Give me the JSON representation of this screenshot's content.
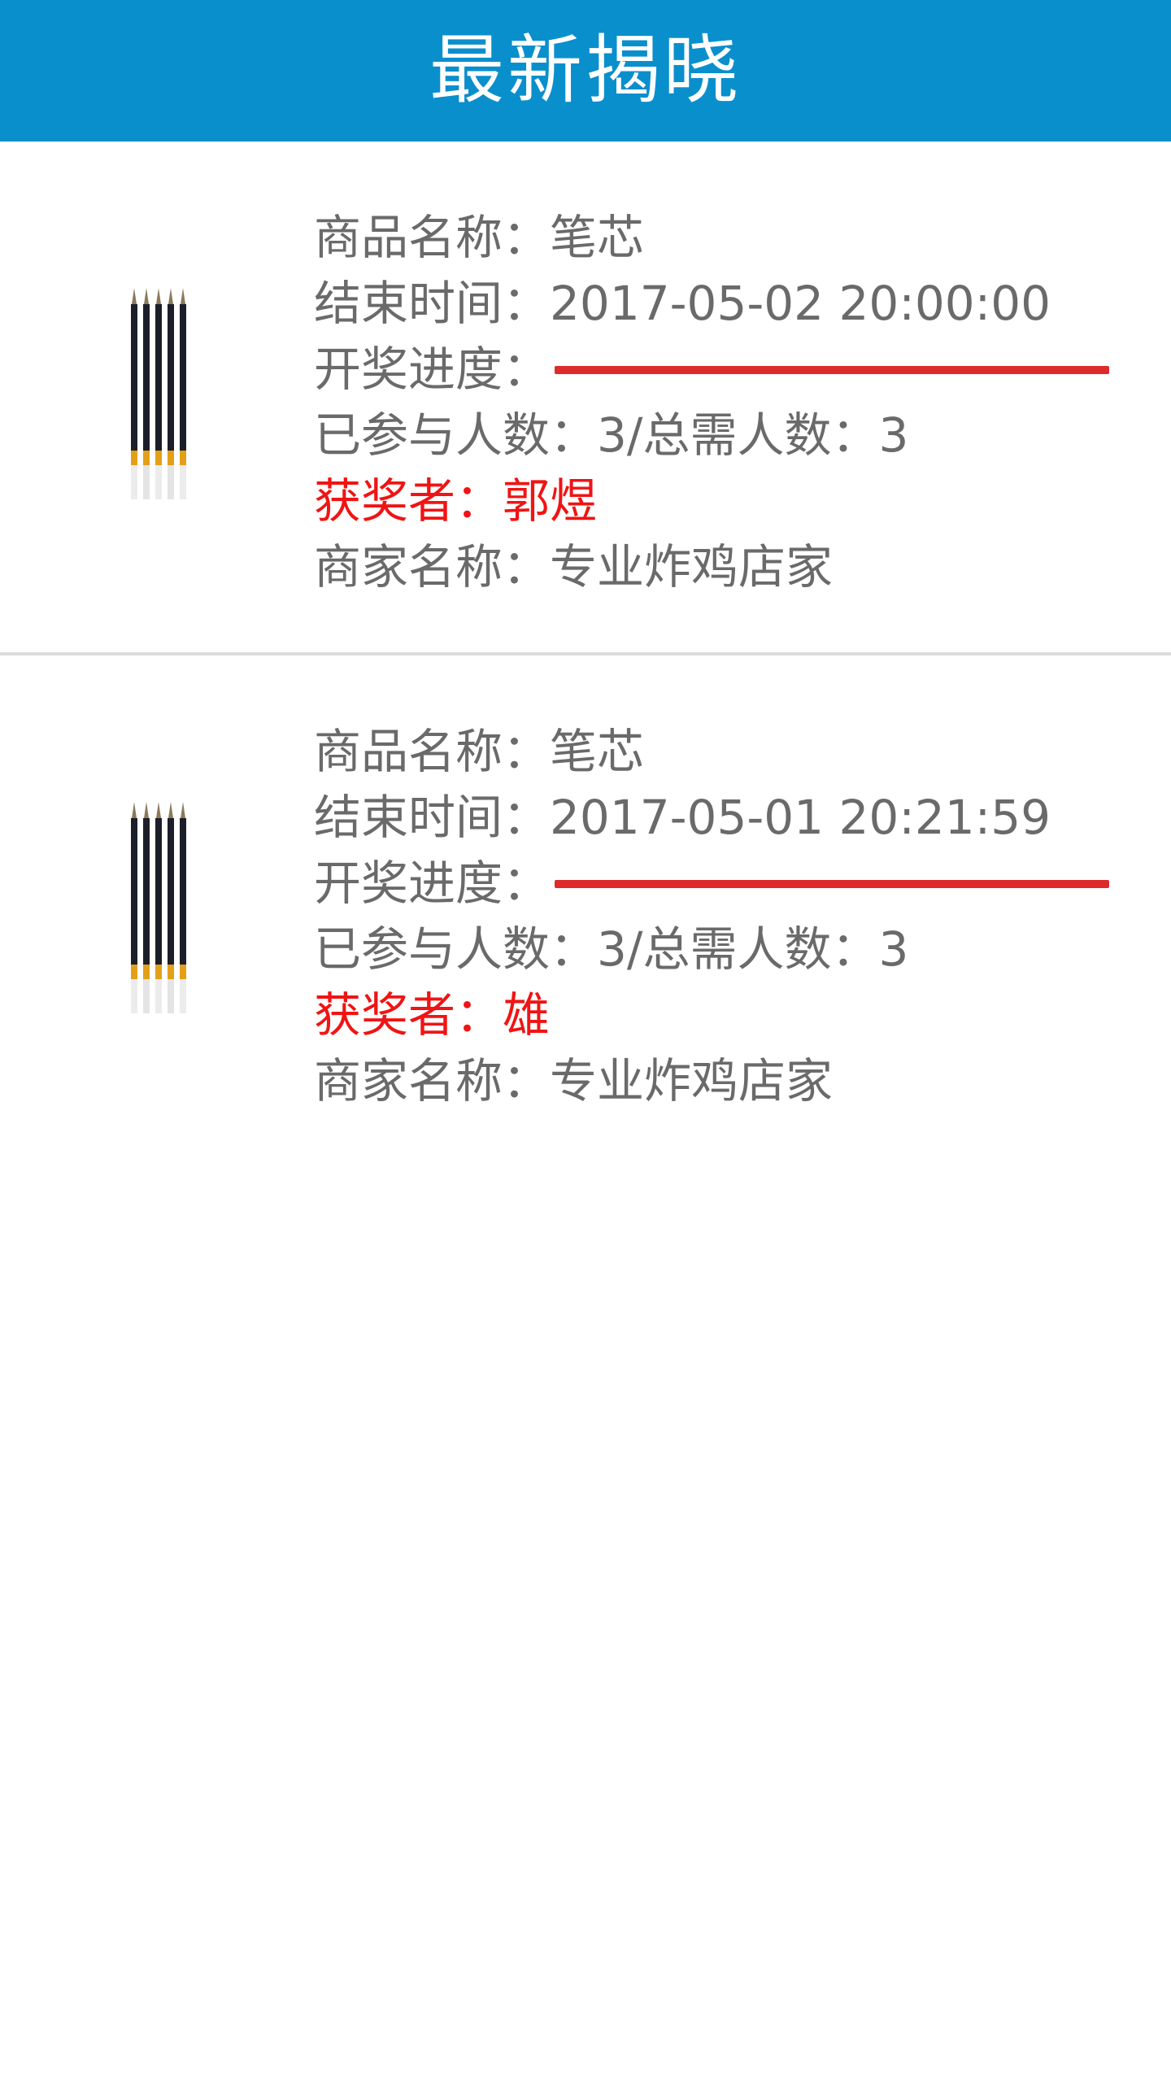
{
  "header": {
    "title": "最新揭晓"
  },
  "items": [
    {
      "product_label": "商品名称：",
      "product_name": "笔芯",
      "end_time_label": "结束时间：",
      "end_time": "2017-05-02 20:00:00",
      "progress_label": "开奖进度：",
      "progress_fraction": 1.0,
      "participants_label": "已参与人数：",
      "participants": "3",
      "total_label": "/总需人数：",
      "total": "3",
      "winner_label": "获奖者：",
      "winner": "郭煜",
      "merchant_label": "商家名称：",
      "merchant": "专业炸鸡店家",
      "image_icon": "pen-refill-image"
    },
    {
      "product_label": "商品名称：",
      "product_name": "笔芯",
      "end_time_label": "结束时间：",
      "end_time": "2017-05-01 20:21:59",
      "progress_label": "开奖进度：",
      "progress_fraction": 1.0,
      "participants_label": "已参与人数：",
      "participants": "3",
      "total_label": "/总需人数：",
      "total": "3",
      "winner_label": "获奖者：",
      "winner": "雄",
      "merchant_label": "商家名称：",
      "merchant": "专业炸鸡店家",
      "image_icon": "pen-refill-image"
    }
  ],
  "colors": {
    "header_bg": "#0a8fcd",
    "text": "#6a6a6a",
    "winner": "#f01414",
    "progress": "#dd2a2a",
    "divider": "#dcdcdc"
  }
}
